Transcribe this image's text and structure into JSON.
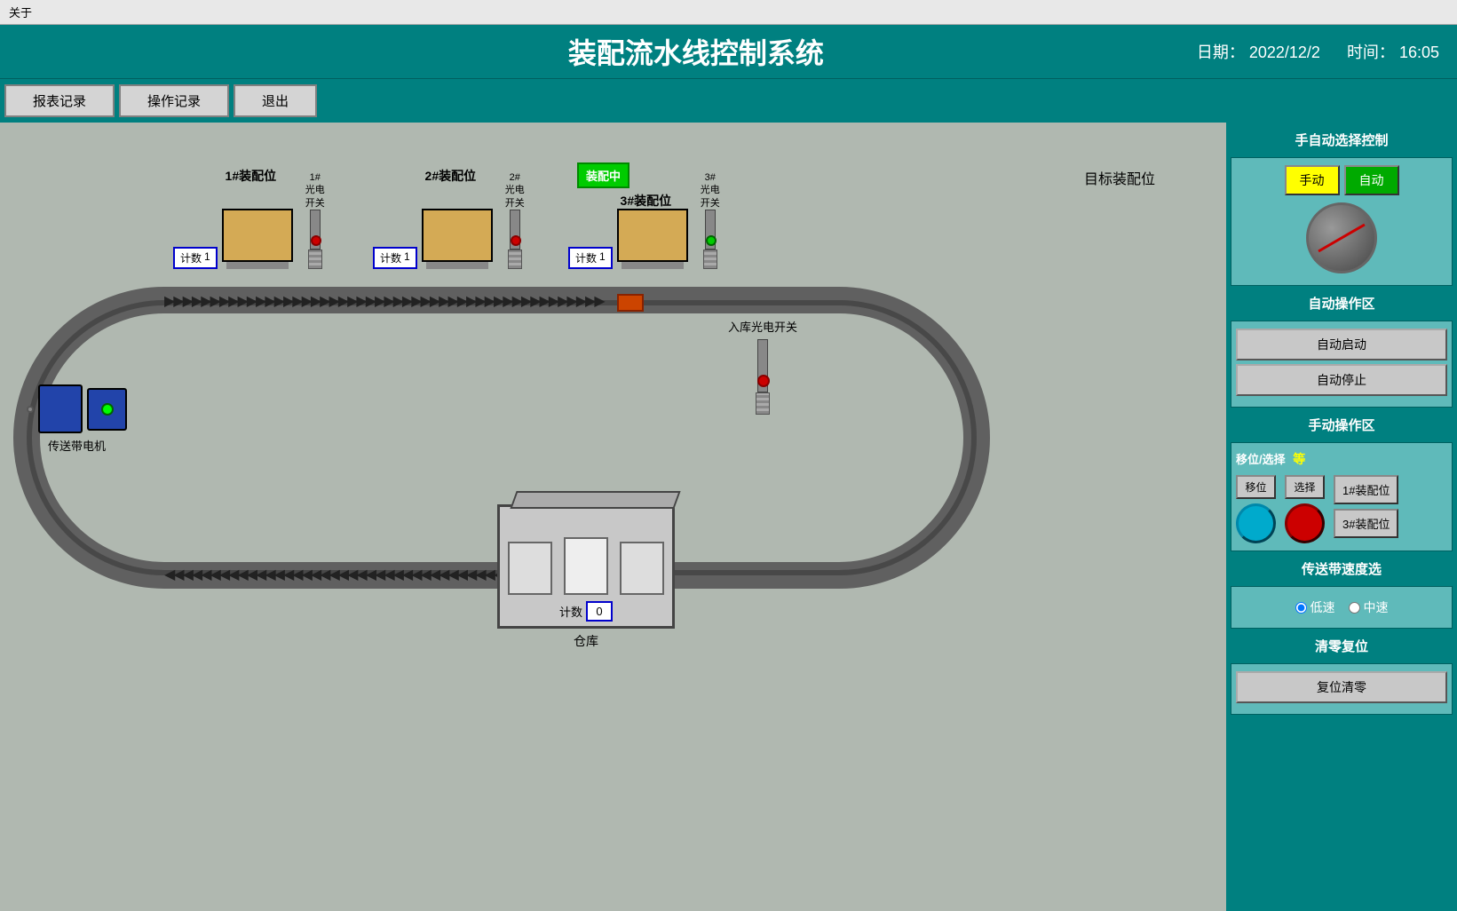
{
  "topbar": {
    "menu": "关于"
  },
  "header": {
    "title": "装配流水线控制系统",
    "date_label": "日期：",
    "date_value": "2022/12/2",
    "time_label": "时间：",
    "time_value": "16:05"
  },
  "nav": {
    "btn1": "报表记录",
    "btn2": "操作记录",
    "btn3": "退出"
  },
  "main": {
    "target_label": "目标装配位",
    "station1_label": "1#装配位",
    "station2_label": "2#装配位",
    "station3_label": "3#装配位",
    "sensor1_label": "1#\n光电\n开关",
    "sensor2_label": "2#\n光电\n开关",
    "sensor3_label": "3#\n光电\n开关",
    "count_label": "计数",
    "count1_value": "1",
    "count2_value": "1",
    "count3_value": "1",
    "assembling_badge": "装配中",
    "motor_label": "传送带电机",
    "warehouse_label": "仓库",
    "warehouse_count_label": "计数",
    "warehouse_count_value": "0",
    "entry_sensor_label": "入库光电开关"
  },
  "right_panel": {
    "mode_title": "手自动选择控制",
    "manual_btn": "手动",
    "auto_btn": "自动",
    "auto_section_title": "自动操作区",
    "auto_start_btn": "自动启动",
    "auto_stop_btn": "自动停止",
    "manual_section_title": "手动操作区",
    "move_select_label": "移位/选择",
    "equal_label": "等",
    "move_btn": "移位",
    "select_btn": "选择",
    "dest1_btn": "1#装配位",
    "dest3_btn": "3#装配位",
    "speed_title": "传送带速度选",
    "speed_low": "低速",
    "speed_mid": "中速",
    "reset_title": "清零复位",
    "reset_btn": "复位清零"
  }
}
